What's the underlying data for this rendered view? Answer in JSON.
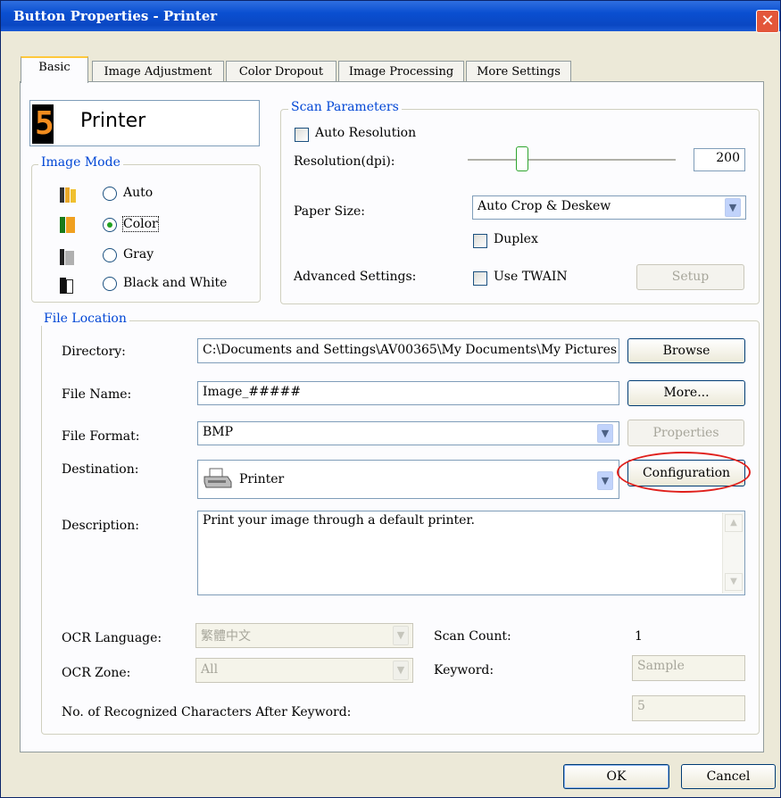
{
  "window": {
    "title": "Button Properties - Printer",
    "close_glyph": "✕"
  },
  "tabs": [
    "Basic",
    "Image Adjustment",
    "Color Dropout",
    "Image Processing",
    "More Settings"
  ],
  "button": {
    "number": "5",
    "name": "Printer"
  },
  "image_mode": {
    "label": "Image Mode",
    "options": [
      {
        "label": "Auto",
        "selected": false
      },
      {
        "label": "Color",
        "selected": true
      },
      {
        "label": "Gray",
        "selected": false
      },
      {
        "label": "Black and White",
        "selected": false
      }
    ]
  },
  "scan_parameters": {
    "label": "Scan Parameters",
    "auto_resolution": "Auto Resolution",
    "resolution_label": "Resolution(dpi):",
    "resolution_value": "200",
    "paper_size_label": "Paper Size:",
    "paper_size_value": "Auto Crop & Deskew",
    "duplex": "Duplex",
    "advanced_label": "Advanced Settings:",
    "use_twain": "Use TWAIN",
    "setup": "Setup"
  },
  "file_location": {
    "label": "File Location",
    "directory_label": "Directory:",
    "directory_value": "C:\\Documents and Settings\\AV00365\\My Documents\\My Pictures",
    "browse": "Browse",
    "file_name_label": "File Name:",
    "file_name_value": "Image_#####",
    "more": "More...",
    "file_format_label": "File Format:",
    "file_format_value": "BMP",
    "properties": "Properties",
    "destination_label": "Destination:",
    "destination_value": "Printer",
    "configuration": "Configuration",
    "description_label": "Description:",
    "description_value": "Print your image through a default printer.",
    "ocr_language_label": "OCR Language:",
    "ocr_language_value": "繁體中文",
    "scan_count_label": "Scan Count:",
    "scan_count_value": "1",
    "ocr_zone_label": "OCR Zone:",
    "ocr_zone_value": "All",
    "keyword_label": "Keyword:",
    "keyword_value": "Sample",
    "recognized_label": "No. of Recognized Characters After Keyword:",
    "recognized_value": "5"
  },
  "footer": {
    "ok": "OK",
    "cancel": "Cancel"
  },
  "colors": {
    "highlight_circle": "#e0201c",
    "title_bar": "#0a4fd1",
    "group_label": "#0046d5"
  }
}
